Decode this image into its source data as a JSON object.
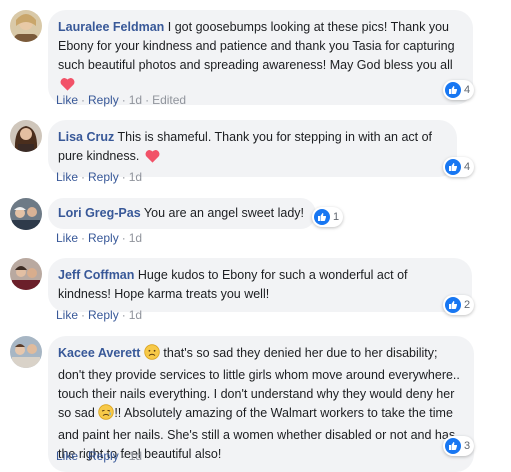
{
  "colors": {
    "name": "#385898",
    "bubble": "#f2f3f5",
    "meta": "#90949c",
    "like": "#1877f2"
  },
  "comments": [
    {
      "author": "Lauralee Feldman",
      "text": "I got goosebumps looking at these pics! Thank you Ebony for your kindness and patience and thank you Tasia for capturing such beautiful photos and spreading awareness! May God bless you all",
      "emoji": "heart-icon",
      "actions": {
        "like": "Like",
        "reply": "Reply",
        "time": "1d",
        "edited": "Edited"
      },
      "reactions": "4"
    },
    {
      "author": "Lisa Cruz",
      "text": "This is shameful. Thank you for stepping in with an act of pure kindness.",
      "emoji": "heart-icon",
      "actions": {
        "like": "Like",
        "reply": "Reply",
        "time": "1d"
      },
      "reactions": "4"
    },
    {
      "author": "Lori Greg-Pas",
      "text": "You are an angel sweet lady!",
      "actions": {
        "like": "Like",
        "reply": "Reply",
        "time": "1d"
      },
      "reactions": "1"
    },
    {
      "author": "Jeff Coffman",
      "text": "Huge kudos to Ebony for such a wonderful act of kindness! Hope karma treats you well!",
      "actions": {
        "like": "Like",
        "reply": "Reply",
        "time": "1d"
      },
      "reactions": "2"
    },
    {
      "author": "Kacee Averett",
      "text_part1": "that's so sad they denied her due to her disability; don't they provide services to little girls whom move around everywhere.. touch their nails everything. I don't understand why they would deny her so sad",
      "text_part2": "!! Absolutely amazing of the Walmart workers to take the time and paint her nails. She's still a women whether disabled or not and has the right to feel beautiful also!",
      "actions": {
        "like": "Like",
        "reply": "Reply",
        "time": "1d"
      },
      "reactions": "3"
    }
  ]
}
